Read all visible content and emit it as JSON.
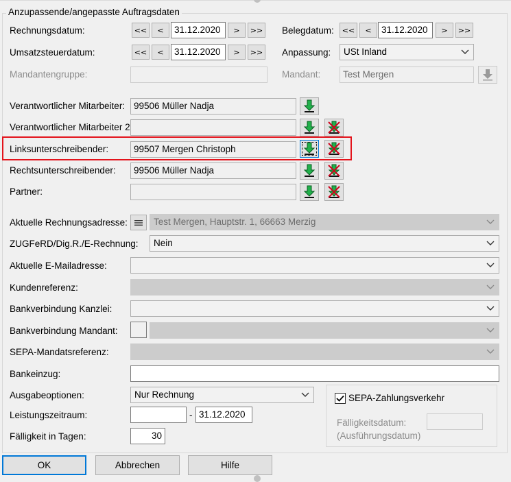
{
  "group": {
    "title": "Anzupassende/angepasste Auftragsdaten"
  },
  "dates": {
    "rechnungsdatum_label": "Rechnungsdatum:",
    "rechnungsdatum_value": "31.12.2020",
    "belegdatum_label": "Belegdatum:",
    "belegdatum_value": "31.12.2020",
    "umsatzsteuerdatum_label": "Umsatzsteuerdatum:",
    "umsatzsteuerdatum_value": "31.12.2020",
    "anpassung_label": "Anpassung:",
    "anpassung_value": "USt Inland",
    "mandantengruppe_label": "Mandantengruppe:",
    "mandantengruppe_value": "",
    "mandant_label": "Mandant:",
    "mandant_value": "Test Mergen"
  },
  "nav": {
    "first": "<<",
    "prev": "<",
    "next": ">",
    "last": ">>"
  },
  "persons": {
    "verantwortlich_label": "Verantwortlicher Mitarbeiter:",
    "verantwortlich_value": "99506 Müller Nadja",
    "verantwortlich2_label": "Verantwortlicher Mitarbeiter 2:",
    "verantwortlich2_value": "",
    "links_label": "Linksunterschreibender:",
    "links_value": "99507 Mergen Christoph",
    "rechts_label": "Rechtsunterschreibender:",
    "rechts_value": "99506 Müller Nadja",
    "partner_label": "Partner:",
    "partner_value": ""
  },
  "billing": {
    "rechnungsadresse_label": "Aktuelle Rechnungsadresse:",
    "rechnungsadresse_value": "Test Mergen, Hauptstr. 1, 66663 Merzig",
    "zugferd_label": "ZUGFeRD/Dig.R./E-Rechnung:",
    "zugferd_value": "Nein",
    "email_label": "Aktuelle E-Mailadresse:",
    "email_value": "",
    "kundenreferenz_label": "Kundenreferenz:",
    "kundenreferenz_value": "",
    "bank_kanzlei_label": "Bankverbindung Kanzlei:",
    "bank_kanzlei_value": "",
    "bank_mandant_label": "Bankverbindung Mandant:",
    "bank_mandant_value": "",
    "sepa_ref_label": "SEPA-Mandatsreferenz:",
    "sepa_ref_value": "",
    "bankeinzug_label": "Bankeinzug:",
    "bankeinzug_value": ""
  },
  "output": {
    "ausgabe_label": "Ausgabeoptionen:",
    "ausgabe_value": "Nur Rechnung",
    "leistungszeitraum_label": "Leistungszeitraum:",
    "leistungszeitraum_from": "",
    "leistungszeitraum_sep": "-",
    "leistungszeitraum_to": "31.12.2020",
    "faelligkeit_label": "Fälligkeit in Tagen:",
    "faelligkeit_value": "30"
  },
  "sepa": {
    "checkbox_label": "SEPA-Zahlungsverkehr",
    "checked": true,
    "faelligkeitsdatum_label": "Fälligkeitsdatum:",
    "ausfuehrungsdatum_label": "(Ausführungsdatum)",
    "faelligkeitsdatum_value": ""
  },
  "footer": {
    "ok": "OK",
    "cancel": "Abbrechen",
    "help": "Hilfe"
  },
  "icons": {
    "pick": "green-down-arrow-icon",
    "clear": "green-arrow-red-x-icon",
    "address": "list-icon",
    "chevron": "chevron-down-icon"
  },
  "colors": {
    "highlight": "#e3131b",
    "accent": "#0078d7",
    "arrow_green": "#21b04b"
  }
}
